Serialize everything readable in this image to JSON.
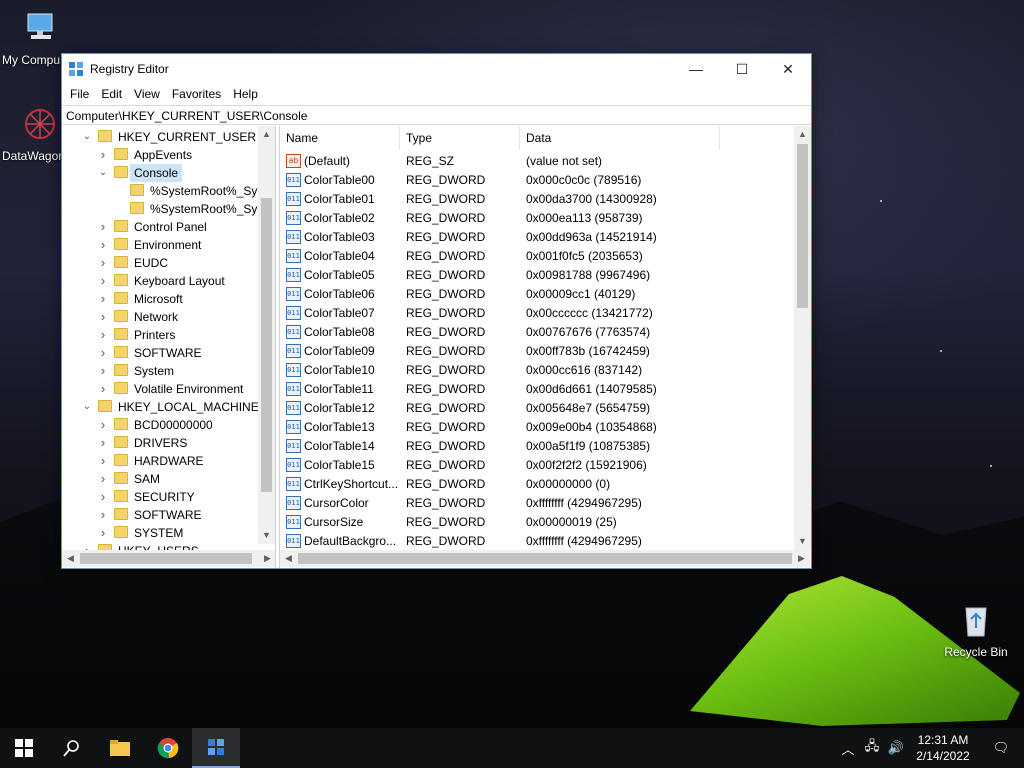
{
  "desktop": {
    "icons": [
      {
        "label": "My Compu"
      },
      {
        "label": "DataWagor"
      },
      {
        "label": "Recycle Bin"
      }
    ]
  },
  "window": {
    "title": "Registry Editor",
    "controls": {
      "minimize": "—",
      "maximize": "☐",
      "close": "✕"
    },
    "menu": [
      "File",
      "Edit",
      "View",
      "Favorites",
      "Help"
    ],
    "address": "Computer\\HKEY_CURRENT_USER\\Console"
  },
  "tree": [
    {
      "label": "HKEY_CURRENT_USER",
      "level": 0,
      "expanded": true
    },
    {
      "label": "AppEvents",
      "level": 1
    },
    {
      "label": "Console",
      "level": 1,
      "expanded": true,
      "selected": true
    },
    {
      "label": "%SystemRoot%_Syst",
      "level": 2,
      "leaf": true
    },
    {
      "label": "%SystemRoot%_Sys\\",
      "level": 2,
      "leaf": true
    },
    {
      "label": "Control Panel",
      "level": 1
    },
    {
      "label": "Environment",
      "level": 1
    },
    {
      "label": "EUDC",
      "level": 1
    },
    {
      "label": "Keyboard Layout",
      "level": 1
    },
    {
      "label": "Microsoft",
      "level": 1
    },
    {
      "label": "Network",
      "level": 1
    },
    {
      "label": "Printers",
      "level": 1
    },
    {
      "label": "SOFTWARE",
      "level": 1
    },
    {
      "label": "System",
      "level": 1
    },
    {
      "label": "Volatile Environment",
      "level": 1
    },
    {
      "label": "HKEY_LOCAL_MACHINE",
      "level": 0,
      "expanded": true
    },
    {
      "label": "BCD00000000",
      "level": 1
    },
    {
      "label": "DRIVERS",
      "level": 1
    },
    {
      "label": "HARDWARE",
      "level": 1
    },
    {
      "label": "SAM",
      "level": 1
    },
    {
      "label": "SECURITY",
      "level": 1
    },
    {
      "label": "SOFTWARE",
      "level": 1
    },
    {
      "label": "SYSTEM",
      "level": 1
    },
    {
      "label": "HKEY_USERS",
      "level": 0
    }
  ],
  "list": {
    "columns": [
      "Name",
      "Type",
      "Data"
    ],
    "rows": [
      {
        "name": "(Default)",
        "type": "REG_SZ",
        "data": "(value not set)",
        "icon": "string-value-icon"
      },
      {
        "name": "ColorTable00",
        "type": "REG_DWORD",
        "data": "0x000c0c0c (789516)",
        "icon": "binary-value-icon"
      },
      {
        "name": "ColorTable01",
        "type": "REG_DWORD",
        "data": "0x00da3700 (14300928)",
        "icon": "binary-value-icon"
      },
      {
        "name": "ColorTable02",
        "type": "REG_DWORD",
        "data": "0x000ea113 (958739)",
        "icon": "binary-value-icon"
      },
      {
        "name": "ColorTable03",
        "type": "REG_DWORD",
        "data": "0x00dd963a (14521914)",
        "icon": "binary-value-icon"
      },
      {
        "name": "ColorTable04",
        "type": "REG_DWORD",
        "data": "0x001f0fc5 (2035653)",
        "icon": "binary-value-icon"
      },
      {
        "name": "ColorTable05",
        "type": "REG_DWORD",
        "data": "0x00981788 (9967496)",
        "icon": "binary-value-icon"
      },
      {
        "name": "ColorTable06",
        "type": "REG_DWORD",
        "data": "0x00009cc1 (40129)",
        "icon": "binary-value-icon"
      },
      {
        "name": "ColorTable07",
        "type": "REG_DWORD",
        "data": "0x00cccccc (13421772)",
        "icon": "binary-value-icon"
      },
      {
        "name": "ColorTable08",
        "type": "REG_DWORD",
        "data": "0x00767676 (7763574)",
        "icon": "binary-value-icon"
      },
      {
        "name": "ColorTable09",
        "type": "REG_DWORD",
        "data": "0x00ff783b (16742459)",
        "icon": "binary-value-icon"
      },
      {
        "name": "ColorTable10",
        "type": "REG_DWORD",
        "data": "0x000cc616 (837142)",
        "icon": "binary-value-icon"
      },
      {
        "name": "ColorTable11",
        "type": "REG_DWORD",
        "data": "0x00d6d661 (14079585)",
        "icon": "binary-value-icon"
      },
      {
        "name": "ColorTable12",
        "type": "REG_DWORD",
        "data": "0x005648e7 (5654759)",
        "icon": "binary-value-icon"
      },
      {
        "name": "ColorTable13",
        "type": "REG_DWORD",
        "data": "0x009e00b4 (10354868)",
        "icon": "binary-value-icon"
      },
      {
        "name": "ColorTable14",
        "type": "REG_DWORD",
        "data": "0x00a5f1f9 (10875385)",
        "icon": "binary-value-icon"
      },
      {
        "name": "ColorTable15",
        "type": "REG_DWORD",
        "data": "0x00f2f2f2 (15921906)",
        "icon": "binary-value-icon"
      },
      {
        "name": "CtrlKeyShortcut...",
        "type": "REG_DWORD",
        "data": "0x00000000 (0)",
        "icon": "binary-value-icon"
      },
      {
        "name": "CursorColor",
        "type": "REG_DWORD",
        "data": "0xffffffff (4294967295)",
        "icon": "binary-value-icon"
      },
      {
        "name": "CursorSize",
        "type": "REG_DWORD",
        "data": "0x00000019 (25)",
        "icon": "binary-value-icon"
      },
      {
        "name": "DefaultBackgro...",
        "type": "REG_DWORD",
        "data": "0xffffffff (4294967295)",
        "icon": "binary-value-icon"
      }
    ]
  },
  "taskbar": {
    "buttons": [
      {
        "name": "start-button",
        "icon": "windows-icon"
      },
      {
        "name": "search-button",
        "icon": "search-icon"
      },
      {
        "name": "file-explorer-button",
        "icon": "folder-icon"
      },
      {
        "name": "chrome-button",
        "icon": "chrome-icon"
      },
      {
        "name": "registry-editor-button",
        "icon": "registry-icon",
        "active": true
      }
    ],
    "tray": {
      "time": "12:31 AM",
      "date": "2/14/2022"
    }
  },
  "colors": {
    "accent": "#0078d7",
    "selection": "#cce4f7",
    "folder": "#f3d36b"
  }
}
